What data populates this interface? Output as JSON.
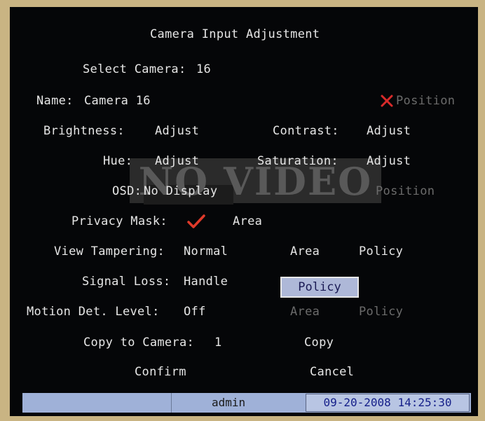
{
  "title": "Camera Input Adjustment",
  "select_camera": {
    "label": "Select Camera:",
    "value": "16"
  },
  "name": {
    "label": "Name:",
    "value": "Camera 16",
    "position_label": "Position"
  },
  "brightness": {
    "label": "Brightness:",
    "button": "Adjust"
  },
  "contrast": {
    "label": "Contrast:",
    "button": "Adjust"
  },
  "hue": {
    "label": "Hue:",
    "button": "Adjust"
  },
  "saturation": {
    "label": "Saturation:",
    "button": "Adjust"
  },
  "overlay": "NO VIDEO",
  "osd": {
    "label": "OSD:",
    "value": "No Display",
    "position_label": "Position"
  },
  "privacy_mask": {
    "label": "Privacy Mask:",
    "checked": true,
    "area_label": "Area"
  },
  "view_tampering": {
    "label": "View Tampering:",
    "value": "Normal",
    "area_label": "Area",
    "policy_label": "Policy"
  },
  "signal_loss": {
    "label": "Signal Loss:",
    "value": "Handle",
    "policy_label": "Policy"
  },
  "motion": {
    "label": "Motion Det. Level:",
    "value": "Off",
    "area_label": "Area",
    "policy_label": "Policy"
  },
  "copy": {
    "label": "Copy to Camera:",
    "value": "1",
    "button": "Copy"
  },
  "confirm_label": "Confirm",
  "cancel_label": "Cancel",
  "status": {
    "user": "admin",
    "datetime": "09-20-2008 14:25:30"
  },
  "colors": {
    "check": "#e03a2a",
    "cross": "#d82a2a",
    "highlight": "#aeb8d8",
    "status_bar": "#9fb1d8"
  },
  "icons": {
    "position_disabled": "x-mark-icon",
    "privacy_mask_checked": "check-mark-icon"
  }
}
